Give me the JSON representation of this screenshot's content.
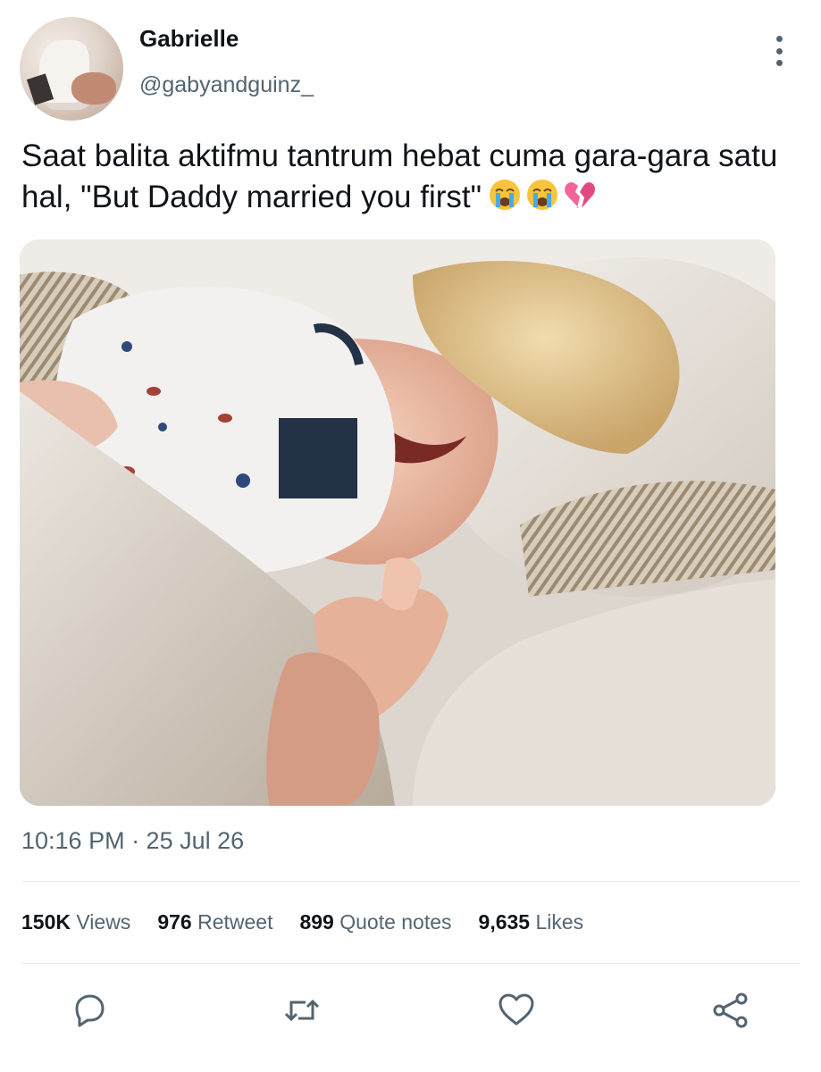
{
  "tweet": {
    "display_name": "Gabrielle",
    "handle": "@gabyandguinz_",
    "text": "Saat balita aktifmu tantrum hebat cuma gara-gara satu hal, \"But Daddy married you first\"",
    "emojis": [
      "crying-face-emoji",
      "crying-face-emoji",
      "broken-heart-emoji"
    ],
    "timestamp": "10:16 PM · 25 Jul 26"
  },
  "stats": [
    {
      "value": "150K",
      "label": "Views"
    },
    {
      "value": "976",
      "label": "Retweet"
    },
    {
      "value": "899",
      "label": "Quote notes"
    },
    {
      "value": "9,635",
      "label": "Likes"
    }
  ],
  "actions": [
    "reply-icon",
    "retweet-icon",
    "like-icon",
    "share-icon"
  ],
  "colors": {
    "text": "#0f1419",
    "secondary": "#536471",
    "divider": "#e5e9ec",
    "emoji_yellow": "#f7c43b",
    "emoji_tear": "#4aa8e6",
    "broken_heart": "#f2649a"
  }
}
